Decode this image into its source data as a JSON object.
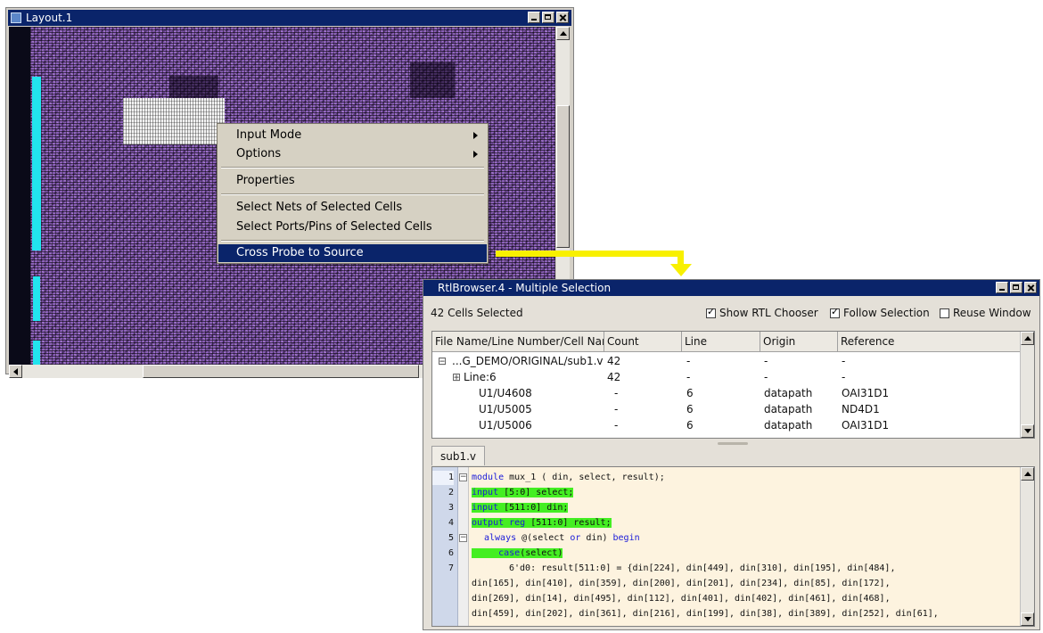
{
  "layout_window": {
    "title": "Layout.1"
  },
  "context_menu": {
    "items": [
      {
        "label": "Input Mode",
        "submenu": true
      },
      {
        "label": "Options",
        "submenu": true
      },
      {
        "label": "Properties",
        "submenu": false
      },
      {
        "label": "Select Nets of Selected Cells",
        "submenu": false
      },
      {
        "label": "Select Ports/Pins of Selected Cells",
        "submenu": false
      },
      {
        "label": "Cross Probe to Source",
        "submenu": false,
        "highlighted": true
      }
    ]
  },
  "rtl_browser": {
    "title": "RtlBrowser.4 - Multiple Selection",
    "selection_count": "42 Cells Selected",
    "options": [
      {
        "label": "Show RTL Chooser",
        "checked": true
      },
      {
        "label": "Follow Selection",
        "checked": true
      },
      {
        "label": "Reuse Window",
        "checked": false
      }
    ],
    "columns": [
      "File Name/Line Number/Cell Nar",
      "Count",
      "Line",
      "Origin",
      "Reference"
    ],
    "rows": [
      {
        "name": "...G_DEMO/ORIGINAL/sub1.v",
        "count": "42",
        "line": "-",
        "origin": "-",
        "reference": "-",
        "expander": "⊟"
      },
      {
        "name": "Line:6",
        "count": "42",
        "line": "-",
        "origin": "-",
        "reference": "-",
        "expander": "⊞"
      },
      {
        "name": "U1/U4608",
        "count": "-",
        "line": "6",
        "origin": "datapath",
        "reference": "OAI31D1"
      },
      {
        "name": "U1/U5005",
        "count": "-",
        "line": "6",
        "origin": "datapath",
        "reference": "ND4D1"
      },
      {
        "name": "U1/U5006",
        "count": "-",
        "line": "6",
        "origin": "datapath",
        "reference": "OAI31D1"
      }
    ],
    "tab": "sub1.v",
    "line_numbers": [
      "1",
      "2",
      "3",
      "4",
      "5",
      "6",
      "7"
    ],
    "code": {
      "l1_kw": "module",
      "l1_rest": " mux_1 ( din, select, result);",
      "l2_kw": "input",
      "l2_rest": " [5:0] select;",
      "l3_kw": "input",
      "l3_rest": " [511:0] din;",
      "l4_kw": "output reg",
      "l4_rest": " [511:0] result;",
      "l5_kw1": "always",
      "l5_mid": " @(select ",
      "l5_kw2": "or",
      "l5_mid2": " din) ",
      "l5_kw3": "begin",
      "l6_kw": "case",
      "l6_rest": "(select)",
      "l7": "6'd0: result[511:0] = {din[224], din[449], din[310], din[195], din[484],",
      "c1": "din[165], din[410], din[359], din[200], din[201], din[234], din[85], din[172],",
      "c2": "din[269], din[14], din[495], din[112], din[401], din[402], din[461], din[468],",
      "c3": "din[459], din[202], din[361], din[216], din[199], din[38], din[389], din[252], din[61],"
    }
  },
  "colors": {
    "titlebar": "#0a246a",
    "layout_canvas": "#8a5fb8",
    "highlight_green": "#44ee22",
    "arrow": "#f8f000",
    "editor_bg": "#fdf3df"
  }
}
